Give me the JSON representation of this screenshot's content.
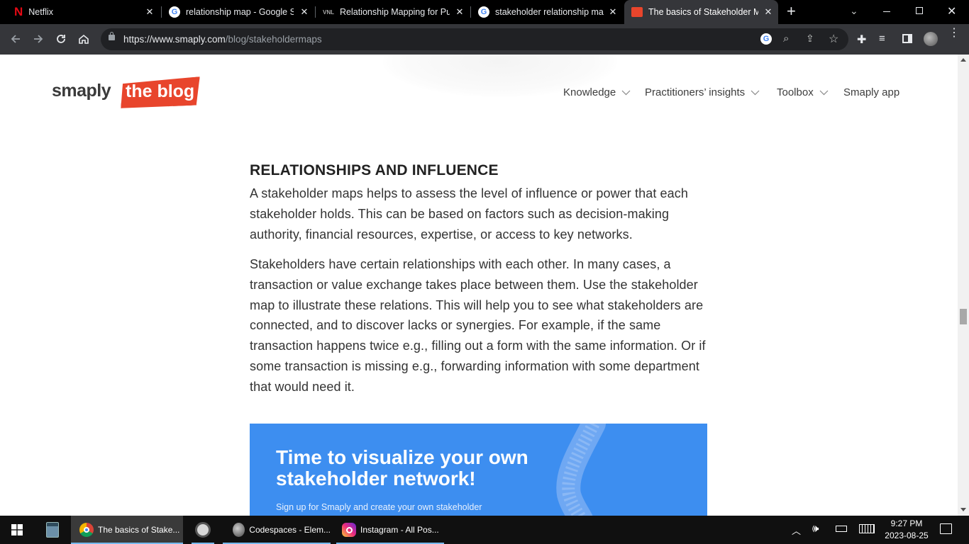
{
  "browser": {
    "tabs": [
      {
        "title": "Netflix"
      },
      {
        "title": "relationship map - Google Se"
      },
      {
        "title": "Relationship Mapping for Pul"
      },
      {
        "title": "stakeholder relationship map"
      },
      {
        "title": "The basics of Stakeholder Ma"
      }
    ],
    "url_host": "https://www.smaply.com",
    "url_path": "/blog/stakeholdermaps"
  },
  "site": {
    "logo_word": "smaply",
    "logo_tag": "the blog",
    "nav": {
      "knowledge": "Knowledge",
      "insights": "Practitioners’ insights",
      "toolbox": "Toolbox",
      "app": "Smaply app"
    }
  },
  "article": {
    "heading": "RELATIONSHIPS AND INFLUENCE",
    "para1": "A stakeholder maps helps to assess the level of influence or power that each stakeholder holds. This can be based on factors such as decision-making authority, financial resources, expertise, or access to key networks.",
    "para2": "Stakeholders have certain relationships with each other. In many cases, a transaction or value exchange takes place between them. Use the stakeholder map to illustrate these relations. This will help you to see what stakeholders are connected, and to discover lacks or synergies. For example, if the same transaction happens twice e.g., filling out a form with the same information. Or if some transaction is missing e.g., forwarding information with some department that would need it."
  },
  "cta": {
    "title_line1": "Time to visualize your own",
    "title_line2": "stakeholder network!",
    "subtitle": "Sign up for Smaply and create your own stakeholder"
  },
  "taskbar": {
    "items": [
      {
        "label": "The basics of Stake..."
      },
      {
        "label": "Codespaces - Elem..."
      },
      {
        "label": "Instagram - All Pos..."
      }
    ],
    "time": "9:27 PM",
    "date": "2023-08-25"
  },
  "colors": {
    "accent_red": "#e8452c",
    "cta_blue": "#3d8ef0",
    "link_blue": "#76b9ed"
  }
}
